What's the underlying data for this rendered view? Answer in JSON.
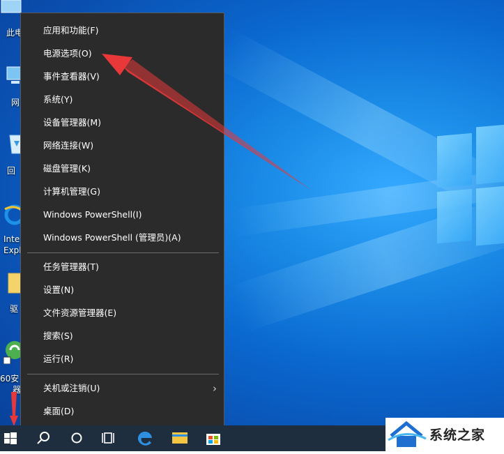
{
  "desktop": {
    "icons": [
      {
        "name": "this-pc",
        "label": "此电"
      },
      {
        "name": "network",
        "label": "网"
      },
      {
        "name": "recycle-bin",
        "label": "回"
      },
      {
        "name": "internet-explorer",
        "label_line1": "Inte",
        "label_line2": "Expl"
      },
      {
        "name": "folder",
        "label": "驱"
      },
      {
        "name": "360-safe",
        "label_line1": "60安",
        "label_line2": "器"
      }
    ]
  },
  "context_menu": {
    "group1": [
      {
        "label": "应用和功能(F)"
      },
      {
        "label": "电源选项(O)"
      },
      {
        "label": "事件查看器(V)"
      },
      {
        "label": "系统(Y)"
      },
      {
        "label": "设备管理器(M)"
      },
      {
        "label": "网络连接(W)"
      },
      {
        "label": "磁盘管理(K)"
      },
      {
        "label": "计算机管理(G)"
      },
      {
        "label": "Windows PowerShell(I)"
      },
      {
        "label": "Windows PowerShell (管理员)(A)"
      }
    ],
    "group2": [
      {
        "label": "任务管理器(T)"
      },
      {
        "label": "设置(N)"
      },
      {
        "label": "文件资源管理器(E)"
      },
      {
        "label": "搜索(S)"
      },
      {
        "label": "运行(R)"
      }
    ],
    "group3": [
      {
        "label": "关机或注销(U)",
        "submenu_glyph": "›"
      },
      {
        "label": "桌面(D)"
      }
    ]
  },
  "taskbar": {
    "buttons": [
      "windows-start-icon",
      "search-icon",
      "cortana-icon",
      "task-view-icon",
      "edge-icon",
      "file-explorer-icon",
      "store-icon"
    ]
  },
  "watermark": {
    "text": "系统之家"
  },
  "colors": {
    "annotation_arrow": "#e8383a",
    "menu_bg": "#2b2b2b",
    "taskbar_bg": "#1e2e3f"
  }
}
